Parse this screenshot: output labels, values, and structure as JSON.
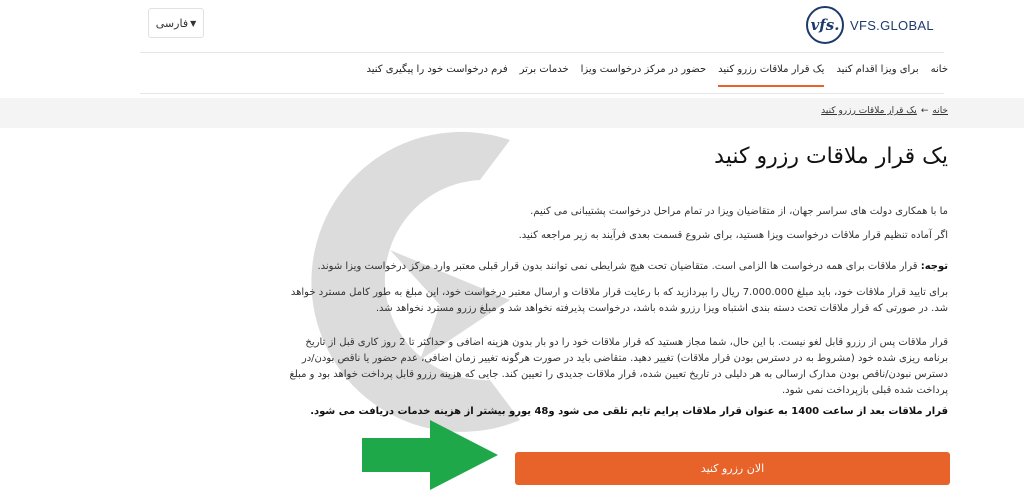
{
  "header": {
    "language_label": "فارسی",
    "logo_mark": "vfs.",
    "logo_text": "VFS.GLOBAL"
  },
  "nav": {
    "items": [
      {
        "label": "خانه"
      },
      {
        "label": "برای ویزا اقدام کنید"
      },
      {
        "label": "یک قرار ملاقات رزرو کنید",
        "active": true
      },
      {
        "label": "حضور در مرکز درخواست ویزا"
      },
      {
        "label": "خدمات برتر"
      },
      {
        "label": "فرم درخواست خود را پیگیری کنید"
      }
    ]
  },
  "breadcrumb": {
    "home": "خانه",
    "separator": "←",
    "current": "یک قرار ملاقات رزرو کنید"
  },
  "main": {
    "title": "یک قرار ملاقات رزرو کنید",
    "p1": "ما با همکاری دولت های سراسر جهان، از متقاضیان ویزا در تمام مراحل درخواست پشتیبانی می کنیم.",
    "p2": "اگر آماده تنظیم قرار ملاقات درخواست ویزا هستید، برای شروع قسمت بعدی فرآیند به زیر مراجعه کنید.",
    "p3_label": "توجه:",
    "p3": " قرار ملاقات برای همه درخواست ها الزامی است. متقاضیان تحت هیچ شرایطی نمی توانند بدون قرار قبلی معتبر وارد مرکز درخواست ویزا شوند.",
    "p4": "برای تایید قرار ملاقات خود، باید مبلغ 7.000.000 ریال را بپردازید که با رعایت قرار ملاقات و ارسال معتبر درخواست خود، این مبلغ به طور کامل مسترد خواهد شد. در صورتی که قرار ملاقات تحت دسته بندی اشتباه ویزا رزرو شده باشد، درخواست پذیرفته نخواهد شد و مبلغ رزرو مسترد نخواهد شد.",
    "p5": "قرار ملاقات پس از رزرو قابل لغو نیست. با این حال، شما مجاز هستید که قرار ملاقات خود را دو بار بدون هزینه اضافی و حداکثر تا 2 روز کاری قبل از تاریخ برنامه ریزی شده خود (مشروط به در دسترس بودن قرار ملاقات) تغییر دهید. متقاضی باید در صورت هرگونه تغییر زمان اضافی، عدم حضور یا ناقص بودن/در دسترس نبودن/ناقص بودن مدارک ارسالی به هر دلیلی در تاریخ تعیین شده، قرار ملاقات جدیدی را تعیین کند. جایی که هزینه رزرو قابل پرداخت خواهد بود و مبلغ پرداخت شده قبلی بازپرداخت نمی شود.",
    "p6": "قرار ملاقات بعد از ساعت 1400 به عنوان قرار ملاقات پرایم تایم تلقی می شود و48 یورو بیشتر از هزینه خدمات دریافت می شود.",
    "book_button": "الان رزرو کنید"
  },
  "colors": {
    "accent": "#e8632a",
    "brand": "#1e3a6b",
    "arrow": "#1fa84a"
  },
  "icons": [
    "caret-down-icon",
    "vfs-logo-icon",
    "watermark-arrow-icon",
    "green-arrow-icon"
  ]
}
